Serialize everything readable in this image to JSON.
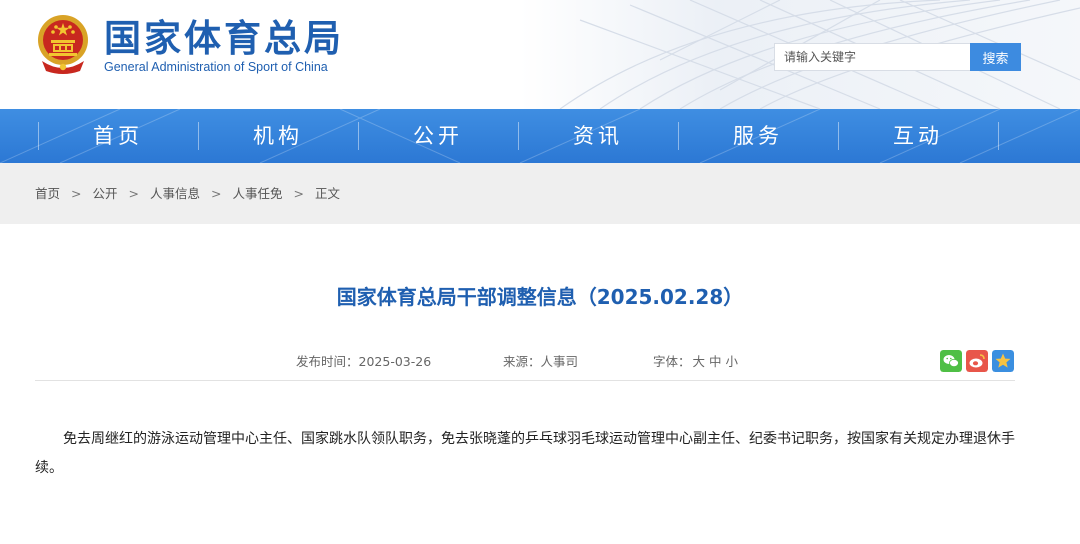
{
  "header": {
    "site_name_cn": "国家体育总局",
    "site_name_en": "General Administration of Sport of China",
    "search_placeholder": "请输入关键字",
    "search_button": "搜索"
  },
  "nav": {
    "items": [
      {
        "label": "首页"
      },
      {
        "label": "机构"
      },
      {
        "label": "公开"
      },
      {
        "label": "资讯"
      },
      {
        "label": "服务"
      },
      {
        "label": "互动"
      }
    ]
  },
  "breadcrumb": {
    "items": [
      "首页",
      "公开",
      "人事信息",
      "人事任免",
      "正文"
    ],
    "separator": ">"
  },
  "article": {
    "title": "国家体育总局干部调整信息（2025.02.28）",
    "publish_label": "发布时间：",
    "publish_date": "2025-03-26",
    "source_label": "来源：",
    "source": "人事司",
    "font_size_label": "字体：",
    "font_sizes": [
      "大",
      "中",
      "小"
    ],
    "body": "免去周继红的游泳运动管理中心主任、国家跳水队领队职务，免去张晓蓬的乒乓球羽毛球运动管理中心副主任、纪委书记职务，按国家有关规定办理退休手续。"
  },
  "share": {
    "icons": [
      "wechat-icon",
      "weibo-icon",
      "favorite-star-icon"
    ]
  },
  "colors": {
    "brand_blue": "#1f5fb0",
    "nav_blue": "#3585dc",
    "search_button": "#3d8be0",
    "breadcrumb_bg": "#efefef",
    "wechat_green": "#4fbf45",
    "weibo_red": "#e8564a",
    "star_bg": "#3b8fe0"
  }
}
